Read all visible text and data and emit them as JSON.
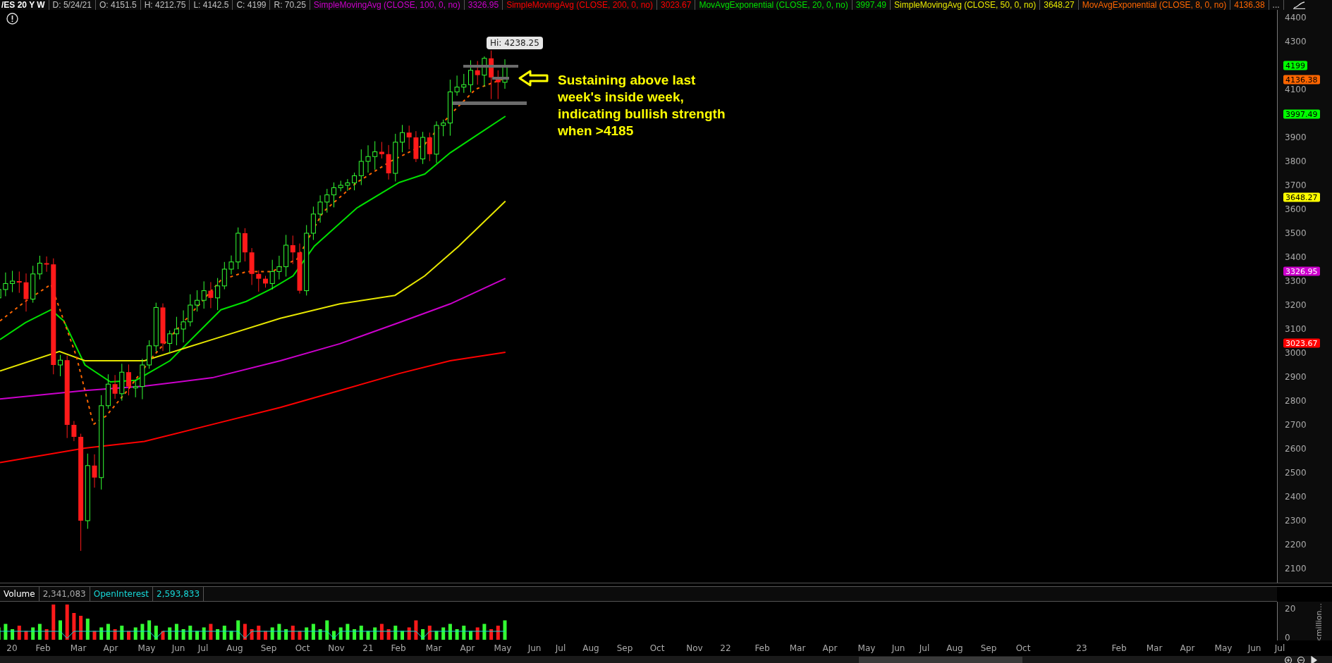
{
  "header": {
    "symbol": "/ES 20 Y W",
    "fields": [
      "D: 5/24/21",
      "O: 4151.5",
      "H: 4212.75",
      "L: 4142.5",
      "C: 4199",
      "R: 70.25"
    ],
    "studies": [
      {
        "name": "SimpleMovingAvg (CLOSE, 100, 0, no)",
        "value": "3326.95",
        "color": "#cc00cc"
      },
      {
        "name": "SimpleMovingAvg (CLOSE, 200, 0, no)",
        "value": "3023.67",
        "color": "#ff0000"
      },
      {
        "name": "MovAvgExponential (CLOSE, 20, 0, no)",
        "value": "3997.49",
        "color": "#00e000"
      },
      {
        "name": "SimpleMovingAvg (CLOSE, 50, 0, no)",
        "value": "3648.27",
        "color": "#e6e600"
      },
      {
        "name": "MovAvgExponential (CLOSE, 8, 0, no)",
        "value": "4136.38",
        "color": "#ff6600"
      }
    ],
    "more": "..."
  },
  "price_chart": {
    "high_bubble": "Hi: 4238.25",
    "annotation": "Sustaining above last week's inside week, indicating bullish strength when >4185"
  },
  "price_axis": {
    "ticks": [
      "4400",
      "4300",
      "4100",
      "3900",
      "3800",
      "3700",
      "3600",
      "3500",
      "3400",
      "3300",
      "3200",
      "3100",
      "3000",
      "2900",
      "2800",
      "2700",
      "2600",
      "2500",
      "2400",
      "2300",
      "2200",
      "2100"
    ],
    "badges": [
      {
        "text": "4199",
        "color": "#00ff00"
      },
      {
        "text": "4136.38",
        "color": "#ff6600"
      },
      {
        "text": "3997.49",
        "color": "#00ff00"
      },
      {
        "text": "3648.27",
        "color": "#ffff00"
      },
      {
        "text": "3326.95",
        "color": "#cc00cc"
      },
      {
        "text": "3023.67",
        "color": "#ff0000"
      }
    ]
  },
  "volume": {
    "label": "Volume",
    "value": "2,341,083",
    "oi_label": "OpenInterest",
    "oi_value": "2,593,833",
    "axis_ticks": [
      "20",
      "0"
    ],
    "unit": "<million..."
  },
  "x_axis": {
    "labels": [
      "20",
      "Feb",
      "Mar",
      "Apr",
      "May",
      "Jun",
      "Jul",
      "Aug",
      "Sep",
      "Oct",
      "Nov",
      "21",
      "Feb",
      "Mar",
      "Apr",
      "May",
      "Jun",
      "Jul",
      "Aug",
      "Sep",
      "Oct",
      "Nov",
      "22",
      "Feb",
      "Mar",
      "Apr",
      "May",
      "Jun",
      "Jul",
      "Aug",
      "Sep",
      "Oct",
      "23",
      "Feb",
      "Mar",
      "Apr",
      "May",
      "Jun",
      "Jul"
    ]
  }
}
